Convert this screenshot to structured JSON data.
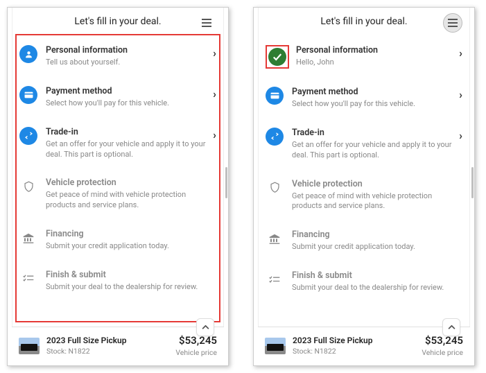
{
  "header": {
    "title": "Let's fill in your deal."
  },
  "steps": {
    "personal": {
      "title": "Personal information",
      "desc_default": "Tell us about yourself.",
      "desc_done": "Hello, John"
    },
    "payment": {
      "title": "Payment method",
      "desc": "Select how you'll pay for this vehicle."
    },
    "tradein": {
      "title": "Trade-in",
      "desc": "Get an offer for your vehicle and apply it to your deal. This part is optional."
    },
    "protection": {
      "title": "Vehicle protection",
      "desc": "Get peace of mind with vehicle protection products and service plans."
    },
    "financing": {
      "title": "Financing",
      "desc": "Submit your credit application today."
    },
    "finish": {
      "title": "Finish & submit",
      "desc": "Submit your deal to the dealership for review."
    }
  },
  "vehicle": {
    "name": "2023 Full Size Pickup",
    "stock": "Stock: N1822",
    "price": "$53,245",
    "price_label": "Vehicle price"
  }
}
